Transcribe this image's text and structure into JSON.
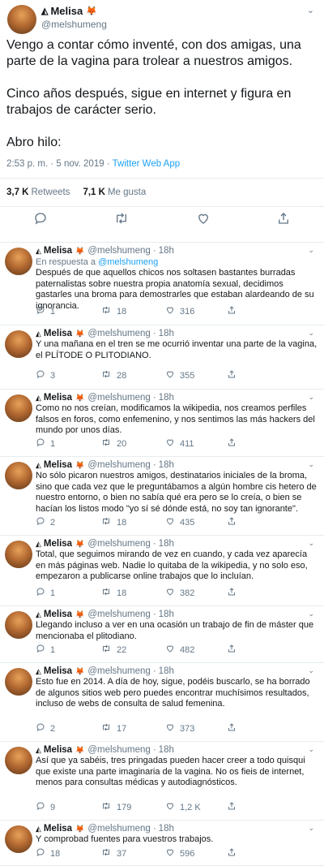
{
  "main": {
    "name": "Melisa",
    "name_glyph": "◭",
    "badge_glyph": "🦊",
    "handle": "@melshumeng",
    "paragraphs": [
      "Vengo a contar cómo inventé, con dos amigas, una parte de la vagina para trolear a nuestros amigos.",
      "Cinco años después, sigue en internet y figura en trabajos de carácter serio.",
      "Abro hilo:"
    ],
    "timestamp": "2:53 p. m. · 5 nov. 2019 · ",
    "app": "Twitter Web App",
    "retweets": "3,7 K",
    "retweets_label": "Retweets",
    "likes": "7,1 K",
    "likes_label": "Me gusta"
  },
  "replies": [
    {
      "name": "Melisa",
      "handle": "@melshumeng",
      "time": "18h",
      "in_reply_prefix": "En respuesta a ",
      "in_reply_handle": "@melshumeng",
      "text": "Después de que aquellos chicos nos soltasen bastantes burradas paternalistas sobre nuestra propia anatomía sexual, decidimos gastarles una broma para demostrarles que estaban alardeando de su ignorancia.",
      "replies": "1",
      "retweets": "18",
      "likes": "316"
    },
    {
      "name": "Melisa",
      "handle": "@melshumeng",
      "time": "18h",
      "text": "Y una mañana en el tren se me ocurrió inventar una parte de la vagina, el PLÍTODE O PLITODIANO.",
      "replies": "3",
      "retweets": "28",
      "likes": "355"
    },
    {
      "name": "Melisa",
      "handle": "@melshumeng",
      "time": "18h",
      "text": "Como no nos creían, modificamos la wikipedia, nos creamos perfiles falsos en foros, como enfemenino, y nos sentimos las más hackers del mundo por unos días.",
      "replies": "1",
      "retweets": "20",
      "likes": "411"
    },
    {
      "name": "Melisa",
      "handle": "@melshumeng",
      "time": "18h",
      "text": "No sólo picaron nuestros amigos, destinatarios iniciales de la broma, sino que cada vez que le preguntábamos a algún hombre cis hetero de nuestro entorno, o bien no sabía qué era pero se lo creía, o bien se hacían los listos modo \"yo sí sé dónde está, no soy tan ignorante\".",
      "replies": "2",
      "retweets": "18",
      "likes": "435"
    },
    {
      "name": "Melisa",
      "handle": "@melshumeng",
      "time": "18h",
      "text": "Total, que seguimos mirando de vez en cuando, y cada vez aparecía en más páginas web. Nadie lo quitaba de la wikipedia, y no solo eso, empezaron a publicarse online trabajos que lo incluían.",
      "replies": "1",
      "retweets": "18",
      "likes": "382"
    },
    {
      "name": "Melisa",
      "handle": "@melshumeng",
      "time": "18h",
      "text": "Llegando incluso a ver en una ocasión un trabajo de fin de máster que mencionaba el plitodiano.",
      "replies": "1",
      "retweets": "22",
      "likes": "482"
    },
    {
      "name": "Melisa",
      "handle": "@melshumeng",
      "time": "18h",
      "text": "Esto fue en 2014. A día de hoy, sigue, podéis buscarlo, se ha borrado de algunos sitios web pero puedes encontrar muchísimos resultados, incluso de webs de consulta de salud femenina.",
      "replies": "2",
      "retweets": "17",
      "likes": "373"
    },
    {
      "name": "Melisa",
      "handle": "@melshumeng",
      "time": "18h",
      "text": "Así que ya sabéis, tres pringadas pueden hacer creer a todo quisqui que existe una parte imaginaria de la vagina. No os fieis de internet, menos para consultas médicas y autodiagnósticos.",
      "replies": "9",
      "retweets": "179",
      "likes": "1,2 K"
    },
    {
      "name": "Melisa",
      "handle": "@melshumeng",
      "time": "18h",
      "text": "Y comprobad fuentes para vuestros trabajos.",
      "replies": "18",
      "retweets": "37",
      "likes": "596"
    }
  ],
  "icons": {
    "reply": "reply-icon",
    "retweet": "retweet-icon",
    "like": "heart-icon",
    "share": "share-icon",
    "chevron": "chevron-down-icon"
  },
  "colors": {
    "link": "#1da1f2",
    "muted": "#657786",
    "text": "#14171a",
    "divider": "#e6ecf0"
  }
}
